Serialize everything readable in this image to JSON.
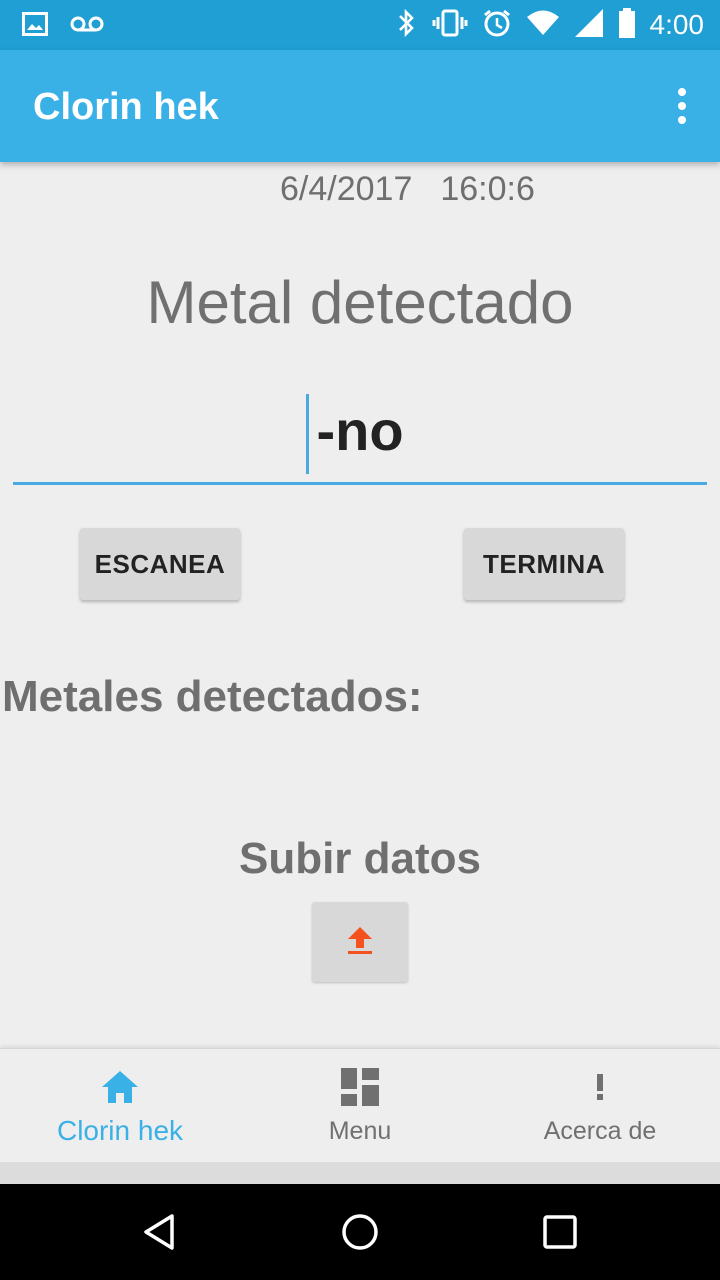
{
  "status_bar": {
    "time": "4:00",
    "left_icons": [
      "image-icon",
      "voicemail-icon"
    ],
    "right_icons": [
      "bluetooth-icon",
      "vibrate-icon",
      "alarm-icon",
      "wifi-icon",
      "signal-icon",
      "battery-icon"
    ]
  },
  "app_bar": {
    "title": "Clorin hek",
    "overflow_icon": "more-vert-icon"
  },
  "main": {
    "date": "6/4/2017",
    "time": "16:0:6",
    "heading": "Metal detectado",
    "input_value": "-no",
    "scan_button": "ESCANEA",
    "stop_button": "TERMINA",
    "detected_label": "Metales detectados:",
    "upload_label": "Subir datos",
    "upload_icon": "upload-icon"
  },
  "bottom_nav": {
    "items": [
      {
        "label": "Clorin hek",
        "icon": "home-icon",
        "active": true
      },
      {
        "label": "Menu",
        "icon": "dashboard-icon",
        "active": false
      },
      {
        "label": "Acerca de",
        "icon": "exclamation-icon",
        "active": false
      }
    ]
  },
  "colors": {
    "status_bar": "#1f9fd4",
    "app_bar": "#3ab1e6",
    "accent": "#3ab1e6",
    "upload_arrow": "#f4511e",
    "background": "#eeeeee"
  }
}
